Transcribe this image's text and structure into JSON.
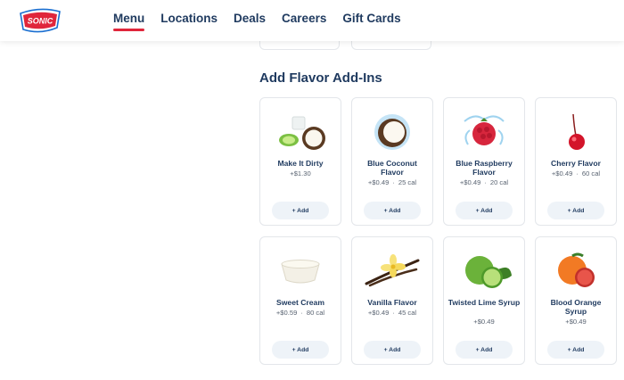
{
  "brand": {
    "logo_text": "SONIC",
    "colors": {
      "red": "#e0263b",
      "navy": "#1f3a5f",
      "blue": "#1a6fd1"
    }
  },
  "nav": [
    {
      "label": "Menu",
      "active": true
    },
    {
      "label": "Locations"
    },
    {
      "label": "Deals"
    },
    {
      "label": "Careers"
    },
    {
      "label": "Gift Cards"
    }
  ],
  "section": {
    "title": "Add Flavor Add-Ins"
  },
  "items": [
    {
      "name": "Make It Dirty",
      "price": "+$1.30",
      "cal": "",
      "button": "+ Add",
      "icon": "coconut-lime-icon"
    },
    {
      "name": "Blue Coconut Flavor",
      "price": "+$0.49",
      "cal": "25 cal",
      "button": "+ Add",
      "icon": "coconut-icon"
    },
    {
      "name": "Blue Raspberry Flavor",
      "price": "+$0.49",
      "cal": "20 cal",
      "button": "+ Add",
      "icon": "raspberry-icon"
    },
    {
      "name": "Cherry Flavor",
      "price": "+$0.49",
      "cal": "60 cal",
      "button": "+ Add",
      "icon": "cherry-icon"
    },
    {
      "name": "Sweet Cream",
      "price": "+$0.59",
      "cal": "80 cal",
      "button": "+ Add",
      "icon": "cream-icon"
    },
    {
      "name": "Vanilla Flavor",
      "price": "+$0.49",
      "cal": "45 cal",
      "button": "+ Add",
      "icon": "vanilla-icon"
    },
    {
      "name": "Twisted Lime Syrup",
      "price": "+$0.49",
      "cal": "",
      "button": "+ Add",
      "icon": "lime-icon"
    },
    {
      "name": "Blood Orange Syrup",
      "price": "+$0.49",
      "cal": "",
      "button": "+ Add",
      "icon": "blood-orange-icon"
    }
  ]
}
